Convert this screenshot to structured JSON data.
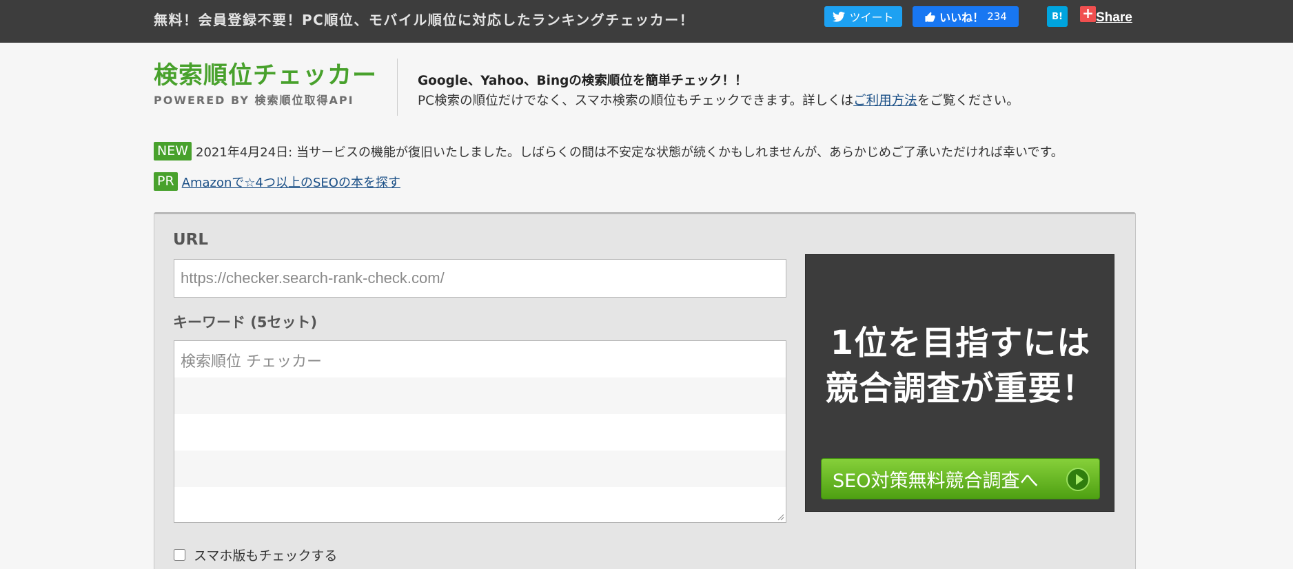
{
  "topbar": {
    "tagline": "無料！会員登録不要！PC順位、モバイル順位に対応したランキングチェッカー！",
    "tweet_label": "ツイート",
    "like_label": "いいね！",
    "like_count": "234",
    "hatena_label": "B!",
    "share_plus": "+",
    "share_label": "Share"
  },
  "header": {
    "logo_title": "検索順位チェッカー",
    "logo_sub": "POWERED BY 検索順位取得API",
    "desc_strong": "Google、Yahoo、Bingの検索順位を簡単チェック！！",
    "desc_line2_before": "PC検索の順位だけでなく、スマホ検索の順位もチェックできます。詳しくは",
    "desc_link": "ご利用方法",
    "desc_line2_after": "をご覧ください。"
  },
  "notices": [
    {
      "badge": "NEW",
      "text": "2021年4月24日: 当サービスの機能が復旧いたしました。しばらくの間は不安定な状態が続くかもしれませんが、あらかじめご了承いただければ幸いです。"
    },
    {
      "badge": "PR",
      "link": "Amazonで☆4つ以上のSEOの本を探す"
    }
  ],
  "form": {
    "url_label": "URL",
    "url_placeholder": "https://checker.search-rank-check.com/",
    "keyword_label": "キーワード (5セット)",
    "keyword_rows": [
      "検索順位 チェッカー",
      "",
      "",
      "",
      ""
    ],
    "mobile_check_label": "スマホ版もチェックする",
    "mobile_checked": false
  },
  "ad": {
    "headline_line1": "1位を目指すには",
    "headline_line2": "競合調査が重要！",
    "cta_label": "SEO対策無料競合調査へ"
  },
  "colors": {
    "topbar_bg": "#3d3d3d",
    "brand_green": "#48a12c",
    "twitter_blue": "#1da1f2",
    "facebook_blue": "#1877f2",
    "hatena_blue": "#00a4de",
    "link_blue": "#1a4f86"
  }
}
